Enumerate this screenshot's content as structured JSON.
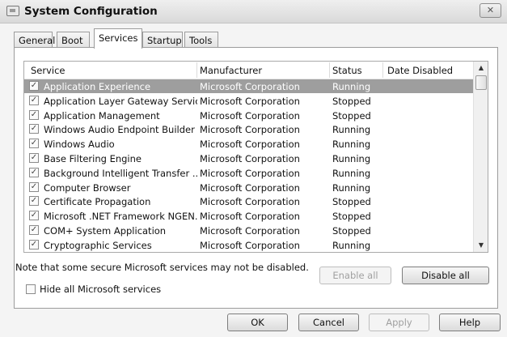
{
  "window": {
    "title": "System Configuration",
    "close_symbol": "✕"
  },
  "tabs": [
    {
      "label": "General",
      "active": false
    },
    {
      "label": "Boot",
      "active": false
    },
    {
      "label": "Services",
      "active": true
    },
    {
      "label": "Startup",
      "active": false
    },
    {
      "label": "Tools",
      "active": false
    }
  ],
  "services": {
    "columns": [
      "Service",
      "Manufacturer",
      "Status",
      "Date Disabled"
    ],
    "selected_index": 0,
    "rows": [
      {
        "service": "Application Experience",
        "manufacturer": "Microsoft Corporation",
        "status": "Running",
        "checked": true
      },
      {
        "service": "Application Layer Gateway Service",
        "manufacturer": "Microsoft Corporation",
        "status": "Stopped",
        "checked": true
      },
      {
        "service": "Application Management",
        "manufacturer": "Microsoft Corporation",
        "status": "Stopped",
        "checked": true
      },
      {
        "service": "Windows Audio Endpoint Builder",
        "manufacturer": "Microsoft Corporation",
        "status": "Running",
        "checked": true
      },
      {
        "service": "Windows Audio",
        "manufacturer": "Microsoft Corporation",
        "status": "Running",
        "checked": true
      },
      {
        "service": "Base Filtering Engine",
        "manufacturer": "Microsoft Corporation",
        "status": "Running",
        "checked": true
      },
      {
        "service": "Background Intelligent Transfer ...",
        "manufacturer": "Microsoft Corporation",
        "status": "Running",
        "checked": true
      },
      {
        "service": "Computer Browser",
        "manufacturer": "Microsoft Corporation",
        "status": "Running",
        "checked": true
      },
      {
        "service": "Certificate Propagation",
        "manufacturer": "Microsoft Corporation",
        "status": "Stopped",
        "checked": true
      },
      {
        "service": "Microsoft .NET Framework NGEN...",
        "manufacturer": "Microsoft Corporation",
        "status": "Stopped",
        "checked": true
      },
      {
        "service": "COM+ System Application",
        "manufacturer": "Microsoft Corporation",
        "status": "Stopped",
        "checked": true
      },
      {
        "service": "Cryptographic Services",
        "manufacturer": "Microsoft Corporation",
        "status": "Running",
        "checked": true
      }
    ],
    "scroll_up_symbol": "▲",
    "scroll_down_symbol": "▼"
  },
  "note": "Note that some secure Microsoft services may not be disabled.",
  "enable_all_label": "Enable all",
  "disable_all_label": "Disable all",
  "hide_ms_label": "Hide all Microsoft services",
  "hide_ms_checked": false,
  "footer": {
    "ok": "OK",
    "cancel": "Cancel",
    "apply": "Apply",
    "help": "Help"
  }
}
